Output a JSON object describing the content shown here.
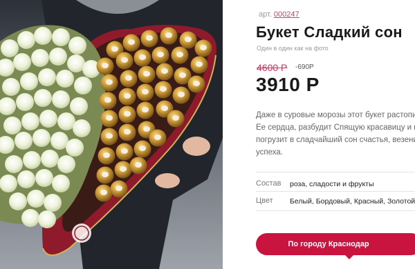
{
  "product": {
    "sku_label": "арт.",
    "sku_code": "000247",
    "title": "Букет Сладкий сон",
    "subtitle": "Один в один как на фото",
    "old_price": "4600 Р",
    "discount": "-690Р",
    "price": "3910 Р",
    "description_lines": [
      "Даже в суровые морозы этот букет растопит",
      "Ее сердца, разбудит Спящую красавицу и вн",
      "погрузит в сладчайший сон счастья, везени",
      "успеха."
    ],
    "attributes": [
      {
        "label": "Состав",
        "value": "роза, сладости и фрукты"
      },
      {
        "label": "Цвет",
        "value": "Белый, Бордовый, Красный, Золотой"
      }
    ]
  },
  "actions": {
    "city_button": "По городу Краснодар"
  },
  "colors": {
    "accent": "#c8143f",
    "old_price": "#c9345f",
    "box": "#8e1a2c"
  },
  "icons": {
    "photo": "bouquet-photo"
  }
}
